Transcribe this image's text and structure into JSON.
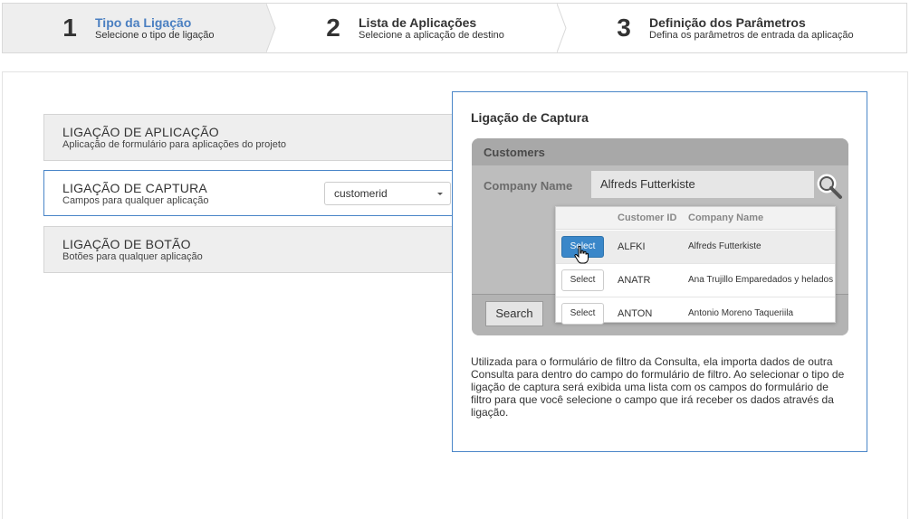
{
  "steps": [
    {
      "number": "1",
      "title": "Tipo da Ligação",
      "subtitle": "Selecione o tipo de ligação"
    },
    {
      "number": "2",
      "title": "Lista de Aplicações",
      "subtitle": "Selecione a aplicação de destino"
    },
    {
      "number": "3",
      "title": "Definição dos Parâmetros",
      "subtitle": "Defina os parâmetros de entrada da aplicação"
    }
  ],
  "options": [
    {
      "name": "LIGAÇÃO DE APLICAÇÃO",
      "desc": "Aplicação de formulário para aplicações do projeto"
    },
    {
      "name": "LIGAÇÃO DE CAPTURA",
      "desc": "Campos para qualquer aplicação"
    },
    {
      "name": "LIGAÇÃO DE BOTÃO",
      "desc": "Botões para qualquer aplicação"
    }
  ],
  "capture_field": {
    "value": "customerid"
  },
  "preview": {
    "title": "Ligação de Captura",
    "mock": {
      "header": "Customers",
      "field_label": "Company Name",
      "field_value": "Alfreds Futterkiste",
      "search_button": "Search",
      "columns": [
        "Customer ID",
        "Company Name"
      ],
      "rows": [
        {
          "button": "Select",
          "id": "ALFKI",
          "name": "Alfreds Futterkiste"
        },
        {
          "button": "Select",
          "id": "ANATR",
          "name": "Ana Trujillo Emparedados y helados"
        },
        {
          "button": "Select",
          "id": "ANTON",
          "name": "Antonio Moreno Taqueriila"
        }
      ]
    },
    "description": "Utilizada para o formulário de filtro da Consulta, ela importa dados de outra Consulta para dentro do campo do formulário de filtro. Ao selecionar o tipo de ligação de captura será exibida uma lista com os campos do formulário de filtro para que você selecione o campo que irá receber os dados através da ligação."
  },
  "colors": {
    "accent": "#4a86c8",
    "active_title": "#4a7fc1",
    "select_primary": "#3a87c9"
  },
  "icons": {
    "magnifier": "search-icon",
    "cursor": "hand-cursor-icon",
    "dropdown": "chevron-down-icon"
  }
}
